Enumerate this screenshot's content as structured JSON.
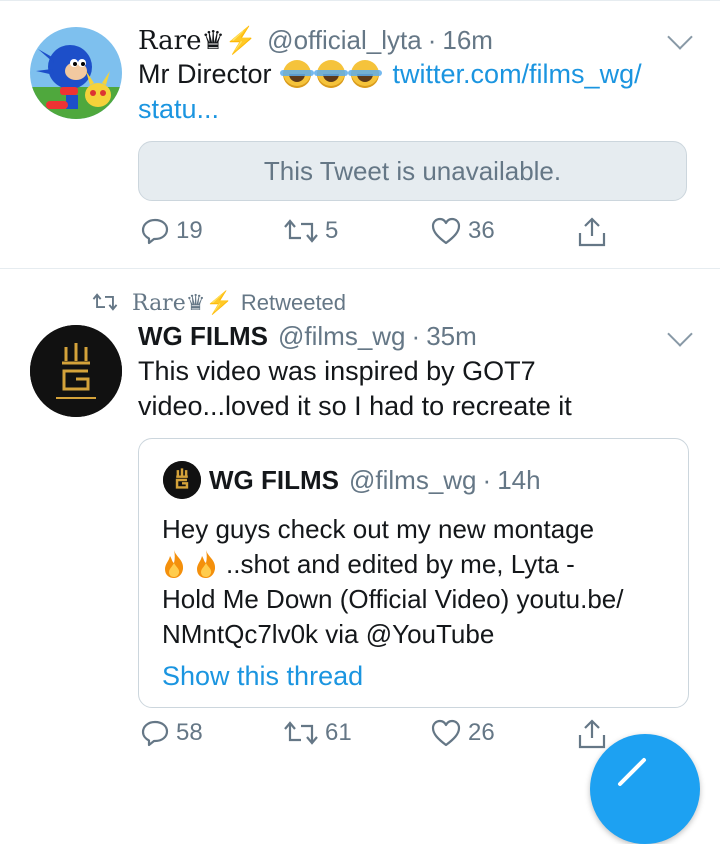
{
  "tweets": [
    {
      "display_name": "Rare♛⚡",
      "handle": "@official_lyta",
      "time": "16m",
      "text_main": "Mr Director",
      "text_link": "twitter.com/films_wg/",
      "text_link2": "statu...",
      "unavailable_text": "This Tweet is unavailable.",
      "reply_count": "19",
      "retweet_count": "5",
      "like_count": "36"
    },
    {
      "retweeted_by": "Rare♛⚡",
      "retweeted_label": "Retweeted",
      "display_name": "WG FILMS",
      "handle": "@films_wg",
      "time": "35m",
      "text_line1": "This video was inspired by GOT7",
      "text_line2": "video...loved it so I had to recreate it",
      "reply_count": "58",
      "retweet_count": "61",
      "like_count": "26",
      "quoted": {
        "display_name": "WG FILMS",
        "handle": "@films_wg",
        "time": "14h",
        "line1": "Hey guys check out my new montage",
        "line2": "..shot and edited by me, Lyta -",
        "line3": "Hold Me Down (Official Video) youtu.be/",
        "line4": "NMntQc7lv0k via @YouTube",
        "show_thread": "Show this thread"
      }
    }
  ],
  "colors": {
    "accent": "#1b95e0",
    "muted": "#657786",
    "divider": "#e6ecf0",
    "fab": "#1da1f2"
  },
  "icons": [
    "reply-icon",
    "retweet-icon",
    "like-icon",
    "share-icon",
    "chevron-down-icon",
    "flame-icon",
    "lightning-icon",
    "crown-icon",
    "compose-icon"
  ]
}
